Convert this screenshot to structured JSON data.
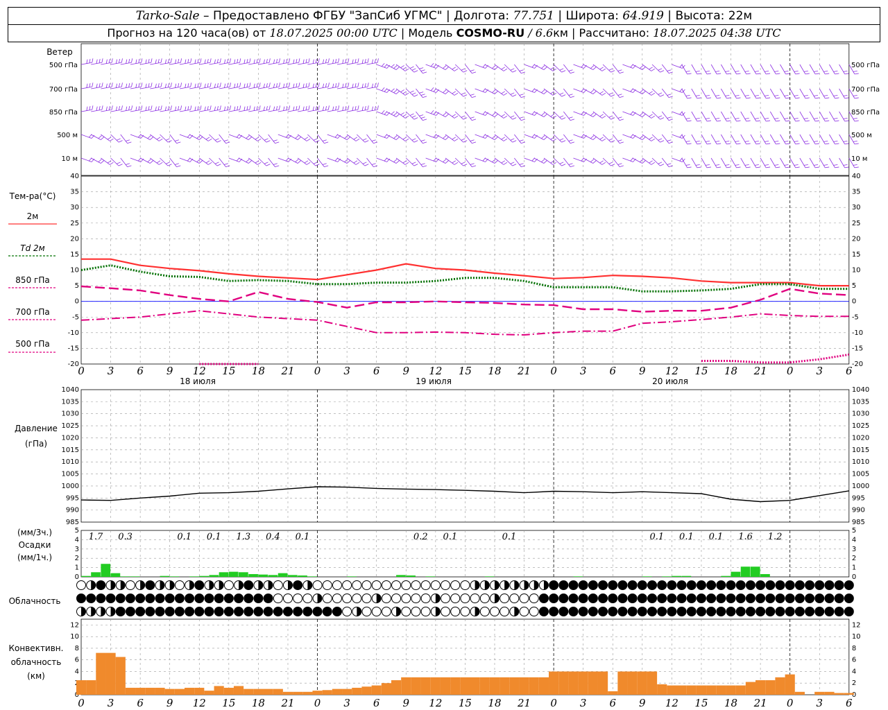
{
  "header": {
    "station": "Tarko-Sale",
    "sep1": " – ",
    "source": "Предоставлено ФГБУ \"ЗапСиб УГМС\"",
    "lon_label": "Долгота:",
    "lon_value": "77.751",
    "lat_label": "Широта:",
    "lat_value": "64.919",
    "alt_label": "Высота:",
    "alt_value": "22м",
    "forecast_prefix": "Прогноз на 120 часа(ов) от",
    "forecast_start": "18.07.2025 00:00 UTC",
    "model_label": "Модель",
    "model_name": "COSMO-RU",
    "model_res": "/ 6.6",
    "model_res_unit": "км",
    "calc_label": "Рассчитано:",
    "calc_value": "18.07.2025 04:38 UTC"
  },
  "colors": {
    "wind": "#8a2be2",
    "t2m": "#ff3030",
    "td2m": "#007000",
    "t850": "#e0007f",
    "t700": "#e0007f",
    "t500": "#e0007f",
    "precip": "#22cc22",
    "convective": "#f08a2c",
    "pressure": "#000000",
    "zero_line": "#0000ff"
  },
  "wind_panel": {
    "title": "Ветер",
    "levels": [
      "500 гПа",
      "700 гПа",
      "850 гПа",
      "500 м",
      "10  м"
    ]
  },
  "temp_panel": {
    "title": "Тем-ра(°С)",
    "legend": [
      {
        "label": "2м",
        "color": "#ff3030",
        "style": "solid"
      },
      {
        "label": "Td  2м",
        "color": "#007000",
        "style": "dotted"
      },
      {
        "label": "850 гПа",
        "color": "#e0007f",
        "style": "dashed"
      },
      {
        "label": "700 гПа",
        "color": "#e0007f",
        "style": "dashdot"
      },
      {
        "label": "500 гПа",
        "color": "#e0007f",
        "style": "dotted"
      }
    ],
    "yticks": [
      40,
      35,
      30,
      25,
      20,
      15,
      10,
      5,
      0,
      -5,
      -10,
      -15,
      -20
    ],
    "day_labels": [
      "18 июля",
      "19 июля",
      "20 июля"
    ]
  },
  "x_hour_ticks": [
    0,
    3,
    6,
    9,
    12,
    15,
    18,
    21,
    0,
    3,
    6,
    9,
    12,
    15,
    18,
    21,
    0,
    3,
    6,
    9,
    12,
    15,
    18,
    21,
    0,
    3,
    6
  ],
  "pressure_panel": {
    "title": "Давление",
    "unit": "(гПа)",
    "yticks": [
      1040,
      1035,
      1030,
      1025,
      1020,
      1015,
      1010,
      1005,
      1000,
      995,
      990,
      985
    ]
  },
  "precip_panel": {
    "unit3": "(мм/3ч.)",
    "title": "Осадки",
    "unit1": "(мм/1ч.)",
    "yticks": [
      5,
      4,
      3,
      2,
      1,
      0
    ],
    "labels_3h": [
      {
        "hour": 0,
        "text": "1.7"
      },
      {
        "hour": 3,
        "text": "0.3"
      },
      {
        "hour": 9,
        "text": "0.1"
      },
      {
        "hour": 12,
        "text": "0.1"
      },
      {
        "hour": 15,
        "text": "1.3"
      },
      {
        "hour": 18,
        "text": "0.4"
      },
      {
        "hour": 21,
        "text": "0.1"
      },
      {
        "hour": 33,
        "text": "0.2"
      },
      {
        "hour": 36,
        "text": "0.1"
      },
      {
        "hour": 42,
        "text": "0.1"
      },
      {
        "hour": 57,
        "text": "0.1"
      },
      {
        "hour": 60,
        "text": "0.1"
      },
      {
        "hour": 63,
        "text": "0.1"
      },
      {
        "hour": 66,
        "text": "1.6"
      },
      {
        "hour": 69,
        "text": "1.2"
      }
    ]
  },
  "cloud_panel": {
    "title": "Облачность"
  },
  "convective_panel": {
    "title1": "Конвективн.",
    "title2": "облачность",
    "unit": "(км)",
    "yticks": [
      12,
      10,
      8,
      6,
      4,
      2,
      0
    ]
  },
  "chart_data": [
    {
      "type": "line",
      "title": "Тем-ра(°С)",
      "x_hours": [
        0,
        3,
        6,
        9,
        12,
        15,
        18,
        21,
        24,
        27,
        30,
        33,
        36,
        39,
        42,
        45,
        48,
        51,
        54,
        57,
        60,
        63,
        66,
        69,
        72,
        75,
        78
      ],
      "ylim": [
        -20,
        40
      ],
      "series": [
        {
          "name": "2м",
          "values": [
            13.5,
            13.5,
            11.5,
            10.5,
            9.8,
            8.8,
            8,
            7.5,
            7,
            8.5,
            10,
            12,
            10.5,
            10,
            9,
            8.2,
            7.3,
            7.6,
            8.3,
            8,
            7.5,
            6.5,
            6,
            6,
            6,
            5,
            5
          ]
        },
        {
          "name": "Td  2м",
          "values": [
            10,
            11.5,
            9.5,
            8,
            7.8,
            6.5,
            6.8,
            6.5,
            5.5,
            5.5,
            6,
            6,
            6.5,
            7.5,
            7.5,
            6.5,
            4.5,
            4.5,
            4.5,
            3.2,
            3.2,
            3.5,
            4,
            5.5,
            5.5,
            4,
            4
          ]
        },
        {
          "name": "850 гПа",
          "values": [
            4.8,
            4.2,
            3.5,
            2,
            0.8,
            0,
            3,
            0.8,
            -0.2,
            -2,
            -0.3,
            -0.3,
            0,
            -0.3,
            -0.5,
            -1,
            -1.2,
            -2.5,
            -2.5,
            -3.3,
            -3,
            -3,
            -2,
            0.5,
            4,
            2.5,
            2
          ]
        },
        {
          "name": "700 гПа",
          "values": [
            -6,
            -5.5,
            -5,
            -4,
            -3,
            -4,
            -5,
            -5.5,
            -6,
            -8,
            -10,
            -10,
            -9.8,
            -10,
            -10.5,
            -10.7,
            -10,
            -9.5,
            -9.5,
            -7,
            -6.5,
            -5.8,
            -5,
            -4,
            -4.5,
            -4.8,
            -4.8
          ]
        },
        {
          "name": "500 гПа",
          "values": [
            null,
            null,
            null,
            null,
            -20,
            -20,
            -20,
            null,
            null,
            null,
            null,
            null,
            null,
            null,
            null,
            null,
            null,
            null,
            null,
            null,
            null,
            -19,
            -19,
            -19.5,
            -19.5,
            -18.5,
            -17
          ]
        }
      ]
    },
    {
      "type": "line",
      "title": "Давление",
      "x_hours": [
        0,
        3,
        6,
        9,
        12,
        15,
        18,
        21,
        24,
        27,
        30,
        33,
        36,
        39,
        42,
        45,
        48,
        51,
        54,
        57,
        60,
        63,
        66,
        69,
        72,
        75,
        78
      ],
      "ylim": [
        985,
        1040
      ],
      "series": [
        {
          "name": "",
          "values": [
            994.2,
            994,
            995,
            995.8,
            997,
            997.2,
            997.8,
            998.8,
            999.7,
            999.5,
            999,
            998.7,
            998.5,
            998.2,
            997.8,
            997.2,
            997.8,
            997.6,
            997.2,
            997.6,
            997.2,
            996.8,
            994.5,
            993.5,
            994,
            996,
            998
          ]
        }
      ]
    },
    {
      "type": "bar",
      "title": "Осадки (мм/1ч.)",
      "ylim": [
        0,
        5
      ],
      "x_hours": [
        1,
        2,
        3,
        4,
        5,
        6,
        9,
        10,
        12,
        13,
        14,
        15,
        16,
        17,
        18,
        19,
        20,
        21,
        22,
        23,
        24,
        28,
        33,
        34,
        36,
        42,
        51,
        58,
        60,
        61,
        62,
        66,
        67,
        68,
        69,
        70
      ],
      "values": [
        0.1,
        0.5,
        1.4,
        0.4,
        0.05,
        0.05,
        0.1,
        0.05,
        0.05,
        0.1,
        0.2,
        0.5,
        0.55,
        0.5,
        0.3,
        0.25,
        0.2,
        0.4,
        0.2,
        0.15,
        0.05,
        0.05,
        0.2,
        0.15,
        0.05,
        0.05,
        0.05,
        0.05,
        0.05,
        0.1,
        0.1,
        0.1,
        0.55,
        1.1,
        1.1,
        0.3
      ]
    },
    {
      "type": "bar",
      "title": "Конвективн. облачность (км)",
      "ylim": [
        0,
        13
      ],
      "x_hours": [
        0,
        1,
        2,
        3,
        4,
        5,
        6,
        7,
        8,
        9,
        10,
        11,
        12,
        13,
        14,
        15,
        16,
        17,
        18,
        19,
        20,
        21,
        22,
        23,
        24,
        25,
        26,
        27,
        28,
        29,
        30,
        31,
        32,
        33,
        34,
        35,
        36,
        37,
        38,
        39,
        40,
        41,
        42,
        43,
        44,
        45,
        46,
        47,
        48,
        49,
        50,
        51,
        52,
        53,
        54,
        55,
        56,
        57,
        58,
        59,
        60,
        61,
        62,
        63,
        64,
        65,
        66,
        67,
        68,
        69,
        70,
        71,
        72,
        73,
        74,
        75,
        76,
        77,
        78
      ],
      "values": [
        2.5,
        2.5,
        7.2,
        7.2,
        6.5,
        1.2,
        1.2,
        1.2,
        1.2,
        1,
        1,
        1.2,
        1.2,
        0.7,
        1.5,
        1.2,
        1.5,
        1,
        1,
        1,
        1,
        0.5,
        0.5,
        0.5,
        0.7,
        0.8,
        1,
        1,
        1.2,
        1.4,
        1.6,
        2,
        2.5,
        3,
        3,
        3,
        3,
        3,
        3,
        3,
        3,
        3,
        3,
        3,
        3,
        3,
        3,
        3,
        4,
        4,
        4,
        4,
        4,
        4,
        0.6,
        4,
        4,
        4,
        4,
        1.8,
        1.6,
        1.6,
        1.6,
        1.6,
        1.6,
        1.6,
        1.6,
        1.6,
        2.2,
        2.5,
        2.5,
        3,
        3.5,
        0.5,
        0,
        0.5,
        0.5,
        0.3,
        0.3
      ]
    }
  ]
}
